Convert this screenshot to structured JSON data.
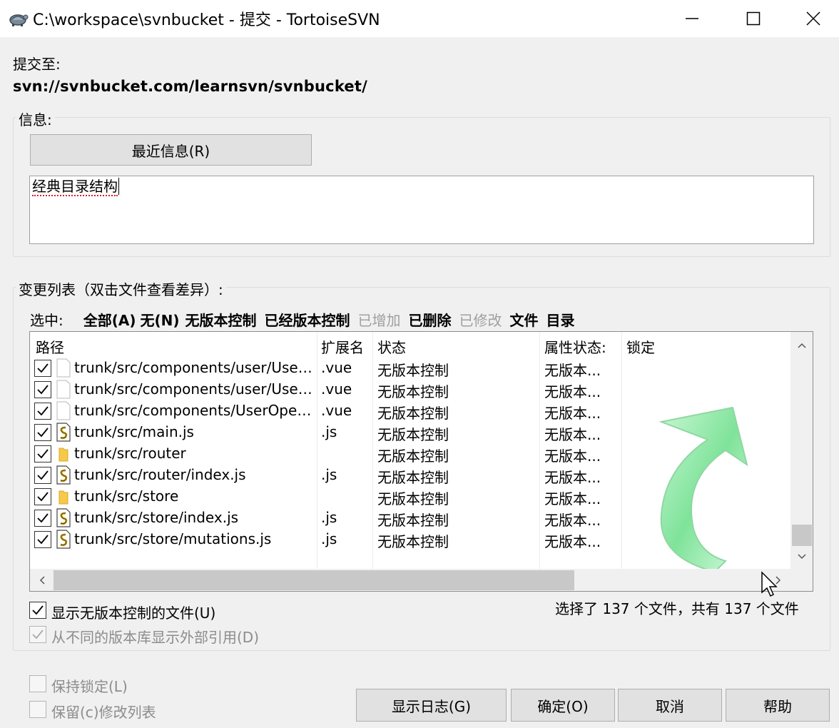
{
  "window": {
    "title": "C:\\workspace\\svnbucket - 提交 - TortoiseSVN",
    "icon": "tortoise-icon",
    "controls": [
      "minimize-icon",
      "maximize-icon",
      "close-icon"
    ]
  },
  "commit_to": {
    "label": "提交至:",
    "url": "svn://svnbucket.com/learnsvn/svnbucket/"
  },
  "message_group": {
    "label": "信息:",
    "recent_button": "最近信息(R)",
    "message_text": "经典目录结构"
  },
  "changes_group": {
    "label": "变更列表（双击文件查看差异）:",
    "select": {
      "prefix": "选中:",
      "all": "全部(A)",
      "none": "无(N)",
      "unversioned": "无版本控制",
      "versioned": "已经版本控制",
      "added": "已增加",
      "deleted": "已删除",
      "modified": "已修改",
      "files": "文件",
      "dirs": "目录"
    },
    "columns": {
      "path": "路径",
      "ext": "扩展名",
      "status": "状态",
      "prop_status": "属性状态:",
      "lock": "锁定"
    },
    "rows": [
      {
        "path": "trunk/src/components/user/User...",
        "ext": ".vue",
        "status": "无版本控制",
        "prop": "无版本...",
        "icon": "file-icon",
        "checked": true
      },
      {
        "path": "trunk/src/components/user/User...",
        "ext": ".vue",
        "status": "无版本控制",
        "prop": "无版本...",
        "icon": "file-icon",
        "checked": true
      },
      {
        "path": "trunk/src/components/UserOper...",
        "ext": ".vue",
        "status": "无版本控制",
        "prop": "无版本...",
        "icon": "file-icon",
        "checked": true
      },
      {
        "path": "trunk/src/main.js",
        "ext": ".js",
        "status": "无版本控制",
        "prop": "无版本...",
        "icon": "js-file-icon",
        "checked": true
      },
      {
        "path": "trunk/src/router",
        "ext": "",
        "status": "无版本控制",
        "prop": "无版本...",
        "icon": "folder-icon",
        "checked": true
      },
      {
        "path": "trunk/src/router/index.js",
        "ext": ".js",
        "status": "无版本控制",
        "prop": "无版本...",
        "icon": "js-file-icon",
        "checked": true
      },
      {
        "path": "trunk/src/store",
        "ext": "",
        "status": "无版本控制",
        "prop": "无版本...",
        "icon": "folder-icon",
        "checked": true
      },
      {
        "path": "trunk/src/store/index.js",
        "ext": ".js",
        "status": "无版本控制",
        "prop": "无版本...",
        "icon": "js-file-icon",
        "checked": true
      },
      {
        "path": "trunk/src/store/mutations.js",
        "ext": ".js",
        "status": "无版本控制",
        "prop": "无版本...",
        "icon": "js-file-icon",
        "checked": true
      }
    ],
    "show_unversioned": {
      "label": "显示无版本控制的文件(U)",
      "checked": true
    },
    "show_externals": {
      "label": "从不同的版本库显示外部引用(D)",
      "checked": true,
      "disabled": true
    },
    "selection_count": "选择了 137 个文件，共有 137 个文件"
  },
  "footer": {
    "keep_locks": {
      "label": "保持锁定(L)",
      "checked": false
    },
    "keep_changelists": {
      "label": "保留(c)修改列表",
      "checked": false
    },
    "show_log": "显示日志(G)",
    "ok": "确定(O)",
    "cancel": "取消",
    "help": "帮助"
  },
  "colors": {
    "window_bg": "#f0f0f0",
    "button_bg": "#e1e1e1",
    "disabled_text": "#a0a0a0",
    "commit_arrow_green": "#7fe39a"
  }
}
